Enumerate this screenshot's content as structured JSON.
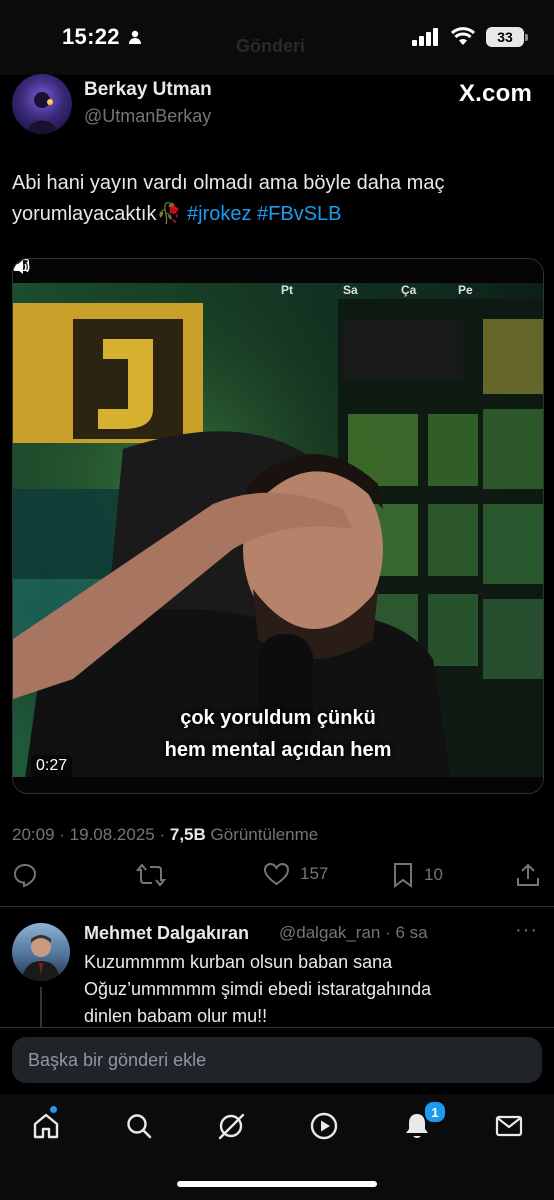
{
  "status_bar": {
    "time": "15:22",
    "battery": "33",
    "ghost_title": "Gönderi"
  },
  "tweet": {
    "display_name": "Berkay Utman",
    "handle": "@UtmanBerkay",
    "source_badge": "X.com",
    "text_line1": "Abi hani yayın vardı olmadı ama böyle daha maç",
    "text_line2_prefix": "yorumlayacaktık",
    "emoji": "🥀",
    "hashtag1": "#jrokez",
    "hashtag2": "#FBvSLB",
    "video": {
      "duration": "0:27",
      "subtitle_line1": "çok yoruldum çünkü",
      "subtitle_line2": "hem mental açıdan hem",
      "overlay_labels": [
        "Pt",
        "Sa",
        "Ça",
        "Pe"
      ]
    },
    "meta": {
      "time": "20:09",
      "date": "19.08.2025",
      "views": "7,5B",
      "views_label": "Görüntülenme"
    },
    "actions": {
      "replies": "",
      "reposts": "",
      "likes": "157",
      "bookmarks": "10"
    }
  },
  "reply": {
    "display_name": "Mehmet Dalgakıran",
    "handle_time": "@dalgak_ran · 6 sa",
    "line1": "Kuzummmm kurban olsun baban sana",
    "line2": "Oğuz’ummmmm şimdi ebedi istaratgahında",
    "line3": "dinlen babam olur mu!!"
  },
  "compose": {
    "placeholder": "Başka bir gönderi ekle"
  },
  "tabbar": {
    "notifications_count": "1"
  },
  "colors": {
    "accent": "#1d9bf0",
    "muted": "#71767b",
    "background": "#000000"
  }
}
